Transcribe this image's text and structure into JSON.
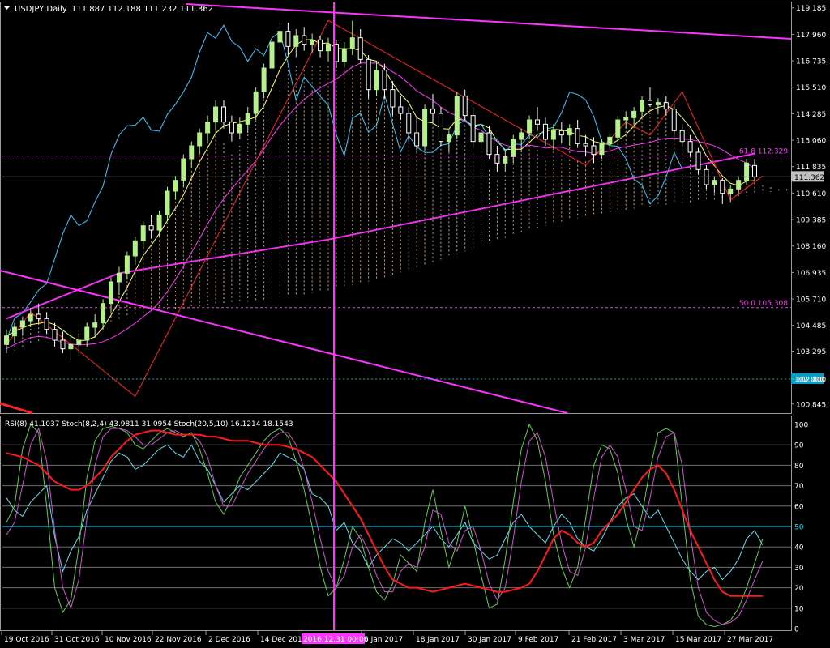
{
  "header": {
    "symbol": "USDJPY,Daily",
    "ohlc": "111.887 112.188 111.232 111.362",
    "indicators": "RSI(8) 41.1037  Stoch(8,2,4) 43.9811 31.0954  Stoch(20,5,10) 16.1214 18.1543"
  },
  "colors": {
    "background": "#000000",
    "grid": "#6e6e6e",
    "axis_text": "#ffffff",
    "candle_up": "#b5f08a",
    "candle_down": "#ffffff",
    "cloud": "#f5c58a",
    "kijun": "#ff33ff",
    "tenkan": "#ffff66",
    "chikou": "#33ccff",
    "ma": "#ee33ee",
    "zigzag": "#ff2222",
    "trendline": "#ff33ff",
    "crosshair": "#ff33ff",
    "rsi": "#66ddee",
    "stoch_fast": "#66cc55",
    "stoch_signal": "#cc55cc",
    "stoch_slow": "#ff1a1a",
    "level_cyan": "#00e5ff",
    "current_price_bg": "#c0c0c0",
    "level_102_bg": "#00a0c8"
  },
  "crosshair_label": "2016.12.31 00:00",
  "fib_levels": [
    {
      "label": "61.8 112.329",
      "value": 112.329
    },
    {
      "label": "50.0 105.308",
      "value": 105.308
    }
  ],
  "current_price": {
    "label": "111.362",
    "value": 111.362
  },
  "level_102": {
    "label": "102.000",
    "value": 102.0
  },
  "chart_data": {
    "type": "candlestick",
    "price_axis": {
      "ticks": [
        "119.185",
        "117.960",
        "116.735",
        "115.510",
        "114.285",
        "113.060",
        "111.835",
        "110.610",
        "109.385",
        "108.160",
        "106.935",
        "105.710",
        "104.485",
        "103.295",
        "102.000",
        "100.845"
      ],
      "ylim": [
        100.5,
        119.4
      ]
    },
    "date_axis": [
      "19 Oct 2016",
      "31 Oct 2016",
      "10 Nov 2016",
      "22 Nov 2016",
      "2 Dec 2016",
      "14 Dec 2016",
      "6 Jan 2017",
      "18 Jan 2017",
      "30 Jan 2017",
      "9 Feb 2017",
      "21 Feb 2017",
      "3 Mar 2017",
      "15 Mar 2017",
      "27 Mar 2017"
    ],
    "candles": [
      [
        103.6,
        104.3,
        103.2,
        104.0
      ],
      [
        104.0,
        104.6,
        103.7,
        104.4
      ],
      [
        104.4,
        104.9,
        104.0,
        104.7
      ],
      [
        104.7,
        105.3,
        104.4,
        105.0
      ],
      [
        105.0,
        105.5,
        104.6,
        104.8
      ],
      [
        104.8,
        105.1,
        104.1,
        104.3
      ],
      [
        104.3,
        104.6,
        103.5,
        103.8
      ],
      [
        103.8,
        104.2,
        103.2,
        103.4
      ],
      [
        103.4,
        103.9,
        102.9,
        103.6
      ],
      [
        103.6,
        104.1,
        103.2,
        103.8
      ],
      [
        103.8,
        104.6,
        103.5,
        104.4
      ],
      [
        104.4,
        105.0,
        103.9,
        104.6
      ],
      [
        104.6,
        105.7,
        104.3,
        105.5
      ],
      [
        105.5,
        106.7,
        105.1,
        106.5
      ],
      [
        106.5,
        107.2,
        105.9,
        106.9
      ],
      [
        106.9,
        107.9,
        106.6,
        107.7
      ],
      [
        107.7,
        108.6,
        107.3,
        108.4
      ],
      [
        108.4,
        109.3,
        108.0,
        109.1
      ],
      [
        109.1,
        109.6,
        108.5,
        108.9
      ],
      [
        108.9,
        109.8,
        108.6,
        109.6
      ],
      [
        109.6,
        110.9,
        109.3,
        110.7
      ],
      [
        110.7,
        111.4,
        110.3,
        111.2
      ],
      [
        111.2,
        112.4,
        110.9,
        112.2
      ],
      [
        112.2,
        113.0,
        111.8,
        112.8
      ],
      [
        112.8,
        113.6,
        112.4,
        113.4
      ],
      [
        113.4,
        114.2,
        113.0,
        113.9
      ],
      [
        113.9,
        114.9,
        113.5,
        114.6
      ],
      [
        114.6,
        114.9,
        113.6,
        113.9
      ],
      [
        113.9,
        114.2,
        113.0,
        113.4
      ],
      [
        113.4,
        114.1,
        113.1,
        113.8
      ],
      [
        113.8,
        114.6,
        113.4,
        114.3
      ],
      [
        114.3,
        115.5,
        114.0,
        115.3
      ],
      [
        115.3,
        116.6,
        115.0,
        116.4
      ],
      [
        116.4,
        117.9,
        116.1,
        117.6
      ],
      [
        117.6,
        118.6,
        117.2,
        118.1
      ],
      [
        118.1,
        118.5,
        117.0,
        117.4
      ],
      [
        117.4,
        118.2,
        116.9,
        117.9
      ],
      [
        117.9,
        118.3,
        117.2,
        117.5
      ],
      [
        117.5,
        118.0,
        117.1,
        117.7
      ],
      [
        117.7,
        117.9,
        116.9,
        117.2
      ],
      [
        117.2,
        117.8,
        116.7,
        117.5
      ],
      [
        117.5,
        117.7,
        116.4,
        116.7
      ],
      [
        116.7,
        117.6,
        116.5,
        117.3
      ],
      [
        117.3,
        118.6,
        117.0,
        117.8
      ],
      [
        117.8,
        118.2,
        116.6,
        116.8
      ],
      [
        116.8,
        117.0,
        115.0,
        115.4
      ],
      [
        115.4,
        116.7,
        115.1,
        116.3
      ],
      [
        116.3,
        116.6,
        115.0,
        115.4
      ],
      [
        115.4,
        115.8,
        114.2,
        114.6
      ],
      [
        114.6,
        115.1,
        114.0,
        114.3
      ],
      [
        114.3,
        114.6,
        113.0,
        113.4
      ],
      [
        113.4,
        114.1,
        112.5,
        112.8
      ],
      [
        112.8,
        114.7,
        112.6,
        114.5
      ],
      [
        114.5,
        115.2,
        113.9,
        114.3
      ],
      [
        114.3,
        114.6,
        112.8,
        113.0
      ],
      [
        113.0,
        113.5,
        112.5,
        113.3
      ],
      [
        113.3,
        115.3,
        113.1,
        115.1
      ],
      [
        115.1,
        115.4,
        114.0,
        114.2
      ],
      [
        114.2,
        114.6,
        112.7,
        113.0
      ],
      [
        113.0,
        113.6,
        112.5,
        113.4
      ],
      [
        113.4,
        113.7,
        112.2,
        112.4
      ],
      [
        112.4,
        112.8,
        111.6,
        112.0
      ],
      [
        112.0,
        112.6,
        111.6,
        112.3
      ],
      [
        112.3,
        113.3,
        112.0,
        113.1
      ],
      [
        113.1,
        113.6,
        112.5,
        113.4
      ],
      [
        113.4,
        114.2,
        113.1,
        114.0
      ],
      [
        114.0,
        114.6,
        113.5,
        113.8
      ],
      [
        113.8,
        114.1,
        112.8,
        113.1
      ],
      [
        113.1,
        113.8,
        112.6,
        113.5
      ],
      [
        113.5,
        113.9,
        112.9,
        113.3
      ],
      [
        113.3,
        113.8,
        112.8,
        113.6
      ],
      [
        113.6,
        114.0,
        112.7,
        112.9
      ],
      [
        112.9,
        113.3,
        112.3,
        112.8
      ],
      [
        112.8,
        113.2,
        112.0,
        112.4
      ],
      [
        112.4,
        113.1,
        112.2,
        112.9
      ],
      [
        112.9,
        113.4,
        112.6,
        113.2
      ],
      [
        113.2,
        114.2,
        113.0,
        114.0
      ],
      [
        114.0,
        114.4,
        113.6,
        114.1
      ],
      [
        114.1,
        114.6,
        113.7,
        114.4
      ],
      [
        114.4,
        115.1,
        114.1,
        114.9
      ],
      [
        114.9,
        115.5,
        114.6,
        114.7
      ],
      [
        114.7,
        115.0,
        114.3,
        114.8
      ],
      [
        114.8,
        115.1,
        114.2,
        114.5
      ],
      [
        114.5,
        114.7,
        113.3,
        113.5
      ],
      [
        113.5,
        113.8,
        112.8,
        113.0
      ],
      [
        113.0,
        113.3,
        112.3,
        112.5
      ],
      [
        112.5,
        112.7,
        111.5,
        111.7
      ],
      [
        111.7,
        111.9,
        110.8,
        111.0
      ],
      [
        111.0,
        111.4,
        110.6,
        111.2
      ],
      [
        111.2,
        111.3,
        110.1,
        110.6
      ],
      [
        110.6,
        111.0,
        110.2,
        110.8
      ],
      [
        110.8,
        111.4,
        110.6,
        111.2
      ],
      [
        111.2,
        112.2,
        111.0,
        112.0
      ],
      [
        111.887,
        112.188,
        111.232,
        111.362
      ]
    ],
    "rsi_scale": {
      "ticks": [
        "100",
        "90",
        "80",
        "70",
        "60",
        "50",
        "40",
        "30",
        "20",
        "10",
        "0"
      ],
      "ylim": [
        0,
        100
      ]
    },
    "series": [
      {
        "name": "RSI(8)",
        "values": [
          64,
          58,
          55,
          62,
          66,
          70,
          45,
          28,
          38,
          45,
          58,
          66,
          74,
          82,
          86,
          84,
          78,
          80,
          84,
          88,
          90,
          86,
          84,
          90,
          82,
          78,
          70,
          62,
          66,
          70,
          68,
          72,
          76,
          80,
          86,
          84,
          82,
          78,
          66,
          64,
          60,
          48,
          52,
          42,
          38,
          30,
          36,
          40,
          44,
          42,
          38,
          42,
          46,
          50,
          44,
          40,
          46,
          52,
          42,
          38,
          34,
          36,
          44,
          52,
          56,
          50,
          46,
          42,
          50,
          56,
          52,
          44,
          40,
          38,
          44,
          52,
          60,
          64,
          66,
          60,
          54,
          58,
          50,
          42,
          34,
          28,
          24,
          28,
          30,
          24,
          28,
          34,
          44,
          48,
          41
        ]
      },
      {
        "name": "Stoch(8,2,4) main",
        "values": [
          52,
          60,
          88,
          100,
          96,
          60,
          20,
          8,
          14,
          40,
          74,
          92,
          98,
          99,
          98,
          96,
          90,
          88,
          92,
          96,
          98,
          96,
          94,
          96,
          88,
          76,
          62,
          56,
          64,
          74,
          80,
          86,
          92,
          96,
          98,
          94,
          82,
          68,
          50,
          30,
          16,
          20,
          34,
          50,
          44,
          30,
          18,
          14,
          22,
          36,
          32,
          28,
          52,
          68,
          48,
          30,
          42,
          60,
          44,
          26,
          10,
          12,
          34,
          62,
          88,
          100,
          92,
          72,
          46,
          30,
          20,
          30,
          54,
          80,
          90,
          88,
          76,
          54,
          40,
          56,
          78,
          96,
          98,
          96,
          60,
          24,
          6,
          2,
          1,
          2,
          4,
          10,
          20,
          32,
          44
        ]
      },
      {
        "name": "Stoch(8,2,4) signal",
        "values": [
          46,
          52,
          70,
          90,
          98,
          82,
          48,
          20,
          10,
          24,
          54,
          80,
          94,
          98,
          98,
          97,
          94,
          90,
          90,
          93,
          96,
          97,
          95,
          95,
          92,
          84,
          70,
          60,
          60,
          68,
          76,
          82,
          88,
          93,
          96,
          96,
          90,
          78,
          62,
          44,
          28,
          20,
          26,
          40,
          46,
          38,
          26,
          18,
          18,
          28,
          32,
          30,
          40,
          58,
          56,
          42,
          38,
          48,
          50,
          38,
          22,
          14,
          20,
          44,
          72,
          92,
          96,
          84,
          62,
          42,
          28,
          26,
          40,
          64,
          84,
          90,
          84,
          68,
          50,
          48,
          64,
          84,
          94,
          96,
          80,
          46,
          20,
          8,
          4,
          2,
          3,
          6,
          14,
          24,
          33
        ]
      },
      {
        "name": "Stoch(20,5,10)",
        "values": [
          86,
          85,
          84,
          82,
          80,
          76,
          72,
          70,
          68,
          68,
          70,
          74,
          78,
          84,
          88,
          92,
          95,
          96,
          97,
          97,
          96,
          95,
          95,
          95,
          95,
          94,
          94,
          93,
          92,
          92,
          92,
          91,
          90,
          90,
          90,
          89,
          88,
          86,
          84,
          80,
          76,
          72,
          66,
          60,
          54,
          46,
          38,
          30,
          24,
          22,
          20,
          20,
          19,
          18,
          19,
          20,
          21,
          22,
          21,
          20,
          19,
          18,
          18,
          19,
          20,
          22,
          28,
          36,
          44,
          48,
          46,
          42,
          40,
          42,
          48,
          52,
          56,
          62,
          68,
          74,
          78,
          80,
          76,
          68,
          58,
          48,
          40,
          32,
          24,
          18,
          16,
          16,
          16,
          16,
          16
        ]
      }
    ]
  }
}
